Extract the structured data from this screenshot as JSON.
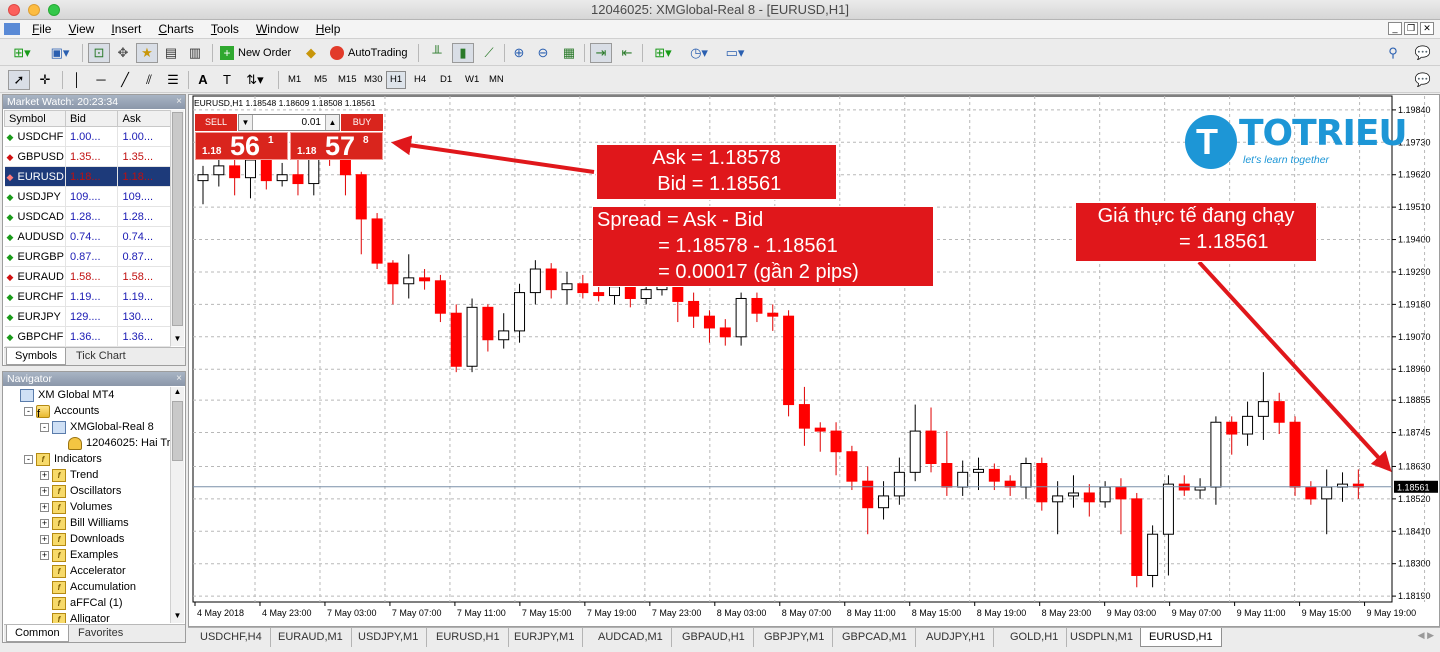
{
  "window": {
    "title": "12046025: XMGlobal-Real 8 - [EURUSD,H1]"
  },
  "menu": [
    "File",
    "View",
    "Insert",
    "Charts",
    "Tools",
    "Window",
    "Help"
  ],
  "toolbar": {
    "new_order": "New Order",
    "autotrading": "AutoTrading"
  },
  "timeframes": [
    "M1",
    "M5",
    "M15",
    "M30",
    "H1",
    "H4",
    "D1",
    "W1",
    "MN"
  ],
  "active_timeframe": "H1",
  "market_watch": {
    "title": "Market Watch: 20:23:34",
    "columns": [
      "Symbol",
      "Bid",
      "Ask"
    ],
    "rows": [
      {
        "symbol": "USDCHF",
        "bid": "1.00...",
        "ask": "1.00...",
        "dir": "up"
      },
      {
        "symbol": "GBPUSD",
        "bid": "1.35...",
        "ask": "1.35...",
        "dir": "dn"
      },
      {
        "symbol": "EURUSD",
        "bid": "1.18...",
        "ask": "1.18...",
        "dir": "dn",
        "selected": true
      },
      {
        "symbol": "USDJPY",
        "bid": "109....",
        "ask": "109....",
        "dir": "up"
      },
      {
        "symbol": "USDCAD",
        "bid": "1.28...",
        "ask": "1.28...",
        "dir": "up"
      },
      {
        "symbol": "AUDUSD",
        "bid": "0.74...",
        "ask": "0.74...",
        "dir": "up"
      },
      {
        "symbol": "EURGBP",
        "bid": "0.87...",
        "ask": "0.87...",
        "dir": "up"
      },
      {
        "symbol": "EURAUD",
        "bid": "1.58...",
        "ask": "1.58...",
        "dir": "dn"
      },
      {
        "symbol": "EURCHF",
        "bid": "1.19...",
        "ask": "1.19...",
        "dir": "up"
      },
      {
        "symbol": "EURJPY",
        "bid": "129....",
        "ask": "130....",
        "dir": "up"
      },
      {
        "symbol": "GBPCHF",
        "bid": "1.36...",
        "ask": "1.36...",
        "dir": "up"
      }
    ],
    "tabs": [
      "Symbols",
      "Tick Chart"
    ]
  },
  "navigator": {
    "title": "Navigator",
    "items": [
      {
        "label": "XM Global MT4",
        "level": 0,
        "icon": "terminal-icon"
      },
      {
        "label": "Accounts",
        "level": 1,
        "icon": "accounts-icon",
        "exp": "-"
      },
      {
        "label": "XMGlobal-Real 8",
        "level": 2,
        "icon": "server-icon",
        "exp": "-"
      },
      {
        "label": "12046025: Hai Tri",
        "level": 3,
        "icon": "user-icon"
      },
      {
        "label": "Indicators",
        "level": 1,
        "icon": "indicator-folder-icon",
        "exp": "-"
      },
      {
        "label": "Trend",
        "level": 2,
        "icon": "indicator-folder-icon",
        "exp": "+"
      },
      {
        "label": "Oscillators",
        "level": 2,
        "icon": "indicator-folder-icon",
        "exp": "+"
      },
      {
        "label": "Volumes",
        "level": 2,
        "icon": "indicator-folder-icon",
        "exp": "+"
      },
      {
        "label": "Bill Williams",
        "level": 2,
        "icon": "indicator-folder-icon",
        "exp": "+"
      },
      {
        "label": "Downloads",
        "level": 2,
        "icon": "indicator-folder-icon",
        "exp": "+"
      },
      {
        "label": "Examples",
        "level": 2,
        "icon": "indicator-folder-icon",
        "exp": "+"
      },
      {
        "label": "Accelerator",
        "level": 2,
        "icon": "indicator-icon"
      },
      {
        "label": "Accumulation",
        "level": 2,
        "icon": "indicator-icon"
      },
      {
        "label": "aFFCal (1)",
        "level": 2,
        "icon": "indicator-icon"
      },
      {
        "label": "Alligator",
        "level": 2,
        "icon": "indicator-icon"
      }
    ],
    "tabs": [
      "Common",
      "Favorites"
    ]
  },
  "trade_panel": {
    "sell_label": "SELL",
    "buy_label": "BUY",
    "lot": "0.01",
    "sell_small": "1.18",
    "sell_big": "56",
    "sell_sup": "1",
    "buy_small": "1.18",
    "buy_big": "57",
    "buy_sup": "8"
  },
  "chart_header": "EURUSD,H1  1.18548 1.18609 1.18508 1.18561",
  "callouts": {
    "ask_bid": "Ask = 1.18578\n Bid = 1.18561",
    "spread": "Spread = Ask - Bid\n           = 1.18578 - 1.18561\n           = 0.00017 (gần 2 pips)",
    "live_price": "Giá thực tế đang chạy\n          = 1.18561"
  },
  "logo": {
    "brand": "TOTRIEU",
    "tagline": "let's learn together"
  },
  "chart_data": {
    "type": "candlestick",
    "symbol": "EURUSD",
    "timeframe": "H1",
    "ylim": [
      1.1817,
      1.1986
    ],
    "current_price": "1.18561",
    "y_ticks": [
      "1.19840",
      "1.19730",
      "1.19620",
      "1.19510",
      "1.19400",
      "1.19290",
      "1.19180",
      "1.19070",
      "1.18960",
      "1.18855",
      "1.18745",
      "1.18630",
      "1.18520",
      "1.18410",
      "1.18300",
      "1.18190"
    ],
    "x_ticks": [
      "4 May 2018",
      "4 May 23:00",
      "7 May 03:00",
      "7 May 07:00",
      "7 May 11:00",
      "7 May 15:00",
      "7 May 19:00",
      "7 May 23:00",
      "8 May 03:00",
      "8 May 07:00",
      "8 May 11:00",
      "8 May 15:00",
      "8 May 19:00",
      "8 May 23:00",
      "9 May 03:00",
      "9 May 07:00",
      "9 May 11:00",
      "9 May 15:00",
      "9 May 19:00"
    ],
    "candles": [
      [
        1.196,
        1.1962,
        1.1965,
        1.1952
      ],
      [
        1.1962,
        1.1965,
        1.1968,
        1.1958
      ],
      [
        1.1965,
        1.1961,
        1.1969,
        1.1955
      ],
      [
        1.1961,
        1.1967,
        1.197,
        1.1954
      ],
      [
        1.1967,
        1.196,
        1.1972,
        1.1957
      ],
      [
        1.196,
        1.1962,
        1.1966,
        1.1958
      ],
      [
        1.1962,
        1.1959,
        1.1968,
        1.1955
      ],
      [
        1.1959,
        1.1973,
        1.1975,
        1.1955
      ],
      [
        1.1973,
        1.197,
        1.1976,
        1.1965
      ],
      [
        1.197,
        1.1962,
        1.1972,
        1.1955
      ],
      [
        1.1962,
        1.1947,
        1.1963,
        1.1935
      ],
      [
        1.1947,
        1.1932,
        1.1949,
        1.193
      ],
      [
        1.1932,
        1.1925,
        1.1933,
        1.1918
      ],
      [
        1.1925,
        1.1927,
        1.1935,
        1.192
      ],
      [
        1.1927,
        1.1926,
        1.193,
        1.1923
      ],
      [
        1.1926,
        1.1915,
        1.1928,
        1.1912
      ],
      [
        1.1915,
        1.1897,
        1.1918,
        1.1895
      ],
      [
        1.1897,
        1.1917,
        1.192,
        1.1895
      ],
      [
        1.1917,
        1.1906,
        1.1918,
        1.1902
      ],
      [
        1.1906,
        1.1909,
        1.1915,
        1.1903
      ],
      [
        1.1909,
        1.1922,
        1.1925,
        1.1905
      ],
      [
        1.1922,
        1.193,
        1.1933,
        1.1918
      ],
      [
        1.193,
        1.1923,
        1.1932,
        1.192
      ],
      [
        1.1923,
        1.1925,
        1.1929,
        1.1918
      ],
      [
        1.1925,
        1.1922,
        1.1928,
        1.192
      ],
      [
        1.1922,
        1.1921,
        1.1925,
        1.1919
      ],
      [
        1.1921,
        1.1924,
        1.1927,
        1.1918
      ],
      [
        1.1924,
        1.192,
        1.1926,
        1.1917
      ],
      [
        1.192,
        1.1923,
        1.1928,
        1.1918
      ],
      [
        1.1923,
        1.1929,
        1.1932,
        1.1921
      ],
      [
        1.1929,
        1.1919,
        1.1931,
        1.1912
      ],
      [
        1.1919,
        1.1914,
        1.1922,
        1.191
      ],
      [
        1.1914,
        1.191,
        1.1916,
        1.1905
      ],
      [
        1.191,
        1.1907,
        1.1913,
        1.1904
      ],
      [
        1.1907,
        1.192,
        1.1922,
        1.1904
      ],
      [
        1.192,
        1.1915,
        1.1922,
        1.1912
      ],
      [
        1.1915,
        1.1914,
        1.1918,
        1.1909
      ],
      [
        1.1914,
        1.1884,
        1.1916,
        1.188
      ],
      [
        1.1884,
        1.1876,
        1.189,
        1.187
      ],
      [
        1.1876,
        1.1875,
        1.1878,
        1.1868
      ],
      [
        1.1875,
        1.1868,
        1.1878,
        1.186
      ],
      [
        1.1868,
        1.1858,
        1.187,
        1.1855
      ],
      [
        1.1858,
        1.1849,
        1.1863,
        1.184
      ],
      [
        1.1849,
        1.1853,
        1.1858,
        1.1845
      ],
      [
        1.1853,
        1.1861,
        1.1866,
        1.185
      ],
      [
        1.1861,
        1.1875,
        1.1884,
        1.1858
      ],
      [
        1.1875,
        1.1864,
        1.1883,
        1.1861
      ],
      [
        1.1864,
        1.1856,
        1.1875,
        1.1853
      ],
      [
        1.1856,
        1.1861,
        1.1865,
        1.1853
      ],
      [
        1.1861,
        1.1862,
        1.1866,
        1.1855
      ],
      [
        1.1862,
        1.1858,
        1.1864,
        1.1855
      ],
      [
        1.1858,
        1.1856,
        1.186,
        1.1853
      ],
      [
        1.1856,
        1.1864,
        1.1866,
        1.1852
      ],
      [
        1.1864,
        1.1851,
        1.1866,
        1.1848
      ],
      [
        1.1851,
        1.1853,
        1.1858,
        1.184
      ],
      [
        1.1853,
        1.1854,
        1.186,
        1.1849
      ],
      [
        1.1854,
        1.1851,
        1.1857,
        1.1846
      ],
      [
        1.1851,
        1.1856,
        1.1858,
        1.1849
      ],
      [
        1.1856,
        1.1852,
        1.1859,
        1.184
      ],
      [
        1.1852,
        1.1826,
        1.1854,
        1.1822
      ],
      [
        1.1826,
        1.184,
        1.1843,
        1.1822
      ],
      [
        1.184,
        1.1857,
        1.186,
        1.1826
      ],
      [
        1.1857,
        1.1855,
        1.186,
        1.1853
      ],
      [
        1.1855,
        1.1856,
        1.1859,
        1.1852
      ],
      [
        1.1856,
        1.1878,
        1.188,
        1.185
      ],
      [
        1.1878,
        1.1874,
        1.188,
        1.1867
      ],
      [
        1.1874,
        1.188,
        1.1885,
        1.187
      ],
      [
        1.188,
        1.1885,
        1.1895,
        1.1872
      ],
      [
        1.1885,
        1.1878,
        1.1888,
        1.1874
      ],
      [
        1.1878,
        1.1856,
        1.188,
        1.1853
      ],
      [
        1.1856,
        1.1852,
        1.1858,
        1.185
      ],
      [
        1.1852,
        1.1856,
        1.1862,
        1.184
      ],
      [
        1.1856,
        1.1857,
        1.1861,
        1.1851
      ],
      [
        1.1857,
        1.1856,
        1.1862,
        1.1852
      ]
    ]
  },
  "symbol_tabs": [
    "USDCHF,H4",
    "EURAUD,M1",
    "USDJPY,M1",
    "EURUSD,H1",
    "EURJPY,M1",
    "AUDCAD,M1",
    "GBPAUD,H1",
    "GBPJPY,M1",
    "GBPCAD,M1",
    "AUDJPY,H1",
    "GOLD,H1",
    "USDPLN,M1",
    "EURUSD,H1"
  ],
  "active_symbol_tab": 12
}
